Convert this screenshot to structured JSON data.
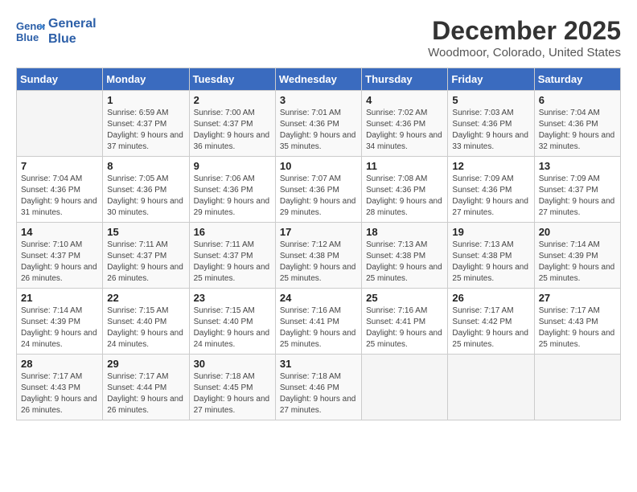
{
  "header": {
    "logo_line1": "General",
    "logo_line2": "Blue",
    "title": "December 2025",
    "subtitle": "Woodmoor, Colorado, United States"
  },
  "weekdays": [
    "Sunday",
    "Monday",
    "Tuesday",
    "Wednesday",
    "Thursday",
    "Friday",
    "Saturday"
  ],
  "weeks": [
    [
      {
        "day": "",
        "sunrise": "",
        "sunset": "",
        "daylight": ""
      },
      {
        "day": "1",
        "sunrise": "Sunrise: 6:59 AM",
        "sunset": "Sunset: 4:37 PM",
        "daylight": "Daylight: 9 hours and 37 minutes."
      },
      {
        "day": "2",
        "sunrise": "Sunrise: 7:00 AM",
        "sunset": "Sunset: 4:37 PM",
        "daylight": "Daylight: 9 hours and 36 minutes."
      },
      {
        "day": "3",
        "sunrise": "Sunrise: 7:01 AM",
        "sunset": "Sunset: 4:36 PM",
        "daylight": "Daylight: 9 hours and 35 minutes."
      },
      {
        "day": "4",
        "sunrise": "Sunrise: 7:02 AM",
        "sunset": "Sunset: 4:36 PM",
        "daylight": "Daylight: 9 hours and 34 minutes."
      },
      {
        "day": "5",
        "sunrise": "Sunrise: 7:03 AM",
        "sunset": "Sunset: 4:36 PM",
        "daylight": "Daylight: 9 hours and 33 minutes."
      },
      {
        "day": "6",
        "sunrise": "Sunrise: 7:04 AM",
        "sunset": "Sunset: 4:36 PM",
        "daylight": "Daylight: 9 hours and 32 minutes."
      }
    ],
    [
      {
        "day": "7",
        "sunrise": "Sunrise: 7:04 AM",
        "sunset": "Sunset: 4:36 PM",
        "daylight": "Daylight: 9 hours and 31 minutes."
      },
      {
        "day": "8",
        "sunrise": "Sunrise: 7:05 AM",
        "sunset": "Sunset: 4:36 PM",
        "daylight": "Daylight: 9 hours and 30 minutes."
      },
      {
        "day": "9",
        "sunrise": "Sunrise: 7:06 AM",
        "sunset": "Sunset: 4:36 PM",
        "daylight": "Daylight: 9 hours and 29 minutes."
      },
      {
        "day": "10",
        "sunrise": "Sunrise: 7:07 AM",
        "sunset": "Sunset: 4:36 PM",
        "daylight": "Daylight: 9 hours and 29 minutes."
      },
      {
        "day": "11",
        "sunrise": "Sunrise: 7:08 AM",
        "sunset": "Sunset: 4:36 PM",
        "daylight": "Daylight: 9 hours and 28 minutes."
      },
      {
        "day": "12",
        "sunrise": "Sunrise: 7:09 AM",
        "sunset": "Sunset: 4:36 PM",
        "daylight": "Daylight: 9 hours and 27 minutes."
      },
      {
        "day": "13",
        "sunrise": "Sunrise: 7:09 AM",
        "sunset": "Sunset: 4:37 PM",
        "daylight": "Daylight: 9 hours and 27 minutes."
      }
    ],
    [
      {
        "day": "14",
        "sunrise": "Sunrise: 7:10 AM",
        "sunset": "Sunset: 4:37 PM",
        "daylight": "Daylight: 9 hours and 26 minutes."
      },
      {
        "day": "15",
        "sunrise": "Sunrise: 7:11 AM",
        "sunset": "Sunset: 4:37 PM",
        "daylight": "Daylight: 9 hours and 26 minutes."
      },
      {
        "day": "16",
        "sunrise": "Sunrise: 7:11 AM",
        "sunset": "Sunset: 4:37 PM",
        "daylight": "Daylight: 9 hours and 25 minutes."
      },
      {
        "day": "17",
        "sunrise": "Sunrise: 7:12 AM",
        "sunset": "Sunset: 4:38 PM",
        "daylight": "Daylight: 9 hours and 25 minutes."
      },
      {
        "day": "18",
        "sunrise": "Sunrise: 7:13 AM",
        "sunset": "Sunset: 4:38 PM",
        "daylight": "Daylight: 9 hours and 25 minutes."
      },
      {
        "day": "19",
        "sunrise": "Sunrise: 7:13 AM",
        "sunset": "Sunset: 4:38 PM",
        "daylight": "Daylight: 9 hours and 25 minutes."
      },
      {
        "day": "20",
        "sunrise": "Sunrise: 7:14 AM",
        "sunset": "Sunset: 4:39 PM",
        "daylight": "Daylight: 9 hours and 25 minutes."
      }
    ],
    [
      {
        "day": "21",
        "sunrise": "Sunrise: 7:14 AM",
        "sunset": "Sunset: 4:39 PM",
        "daylight": "Daylight: 9 hours and 24 minutes."
      },
      {
        "day": "22",
        "sunrise": "Sunrise: 7:15 AM",
        "sunset": "Sunset: 4:40 PM",
        "daylight": "Daylight: 9 hours and 24 minutes."
      },
      {
        "day": "23",
        "sunrise": "Sunrise: 7:15 AM",
        "sunset": "Sunset: 4:40 PM",
        "daylight": "Daylight: 9 hours and 24 minutes."
      },
      {
        "day": "24",
        "sunrise": "Sunrise: 7:16 AM",
        "sunset": "Sunset: 4:41 PM",
        "daylight": "Daylight: 9 hours and 25 minutes."
      },
      {
        "day": "25",
        "sunrise": "Sunrise: 7:16 AM",
        "sunset": "Sunset: 4:41 PM",
        "daylight": "Daylight: 9 hours and 25 minutes."
      },
      {
        "day": "26",
        "sunrise": "Sunrise: 7:17 AM",
        "sunset": "Sunset: 4:42 PM",
        "daylight": "Daylight: 9 hours and 25 minutes."
      },
      {
        "day": "27",
        "sunrise": "Sunrise: 7:17 AM",
        "sunset": "Sunset: 4:43 PM",
        "daylight": "Daylight: 9 hours and 25 minutes."
      }
    ],
    [
      {
        "day": "28",
        "sunrise": "Sunrise: 7:17 AM",
        "sunset": "Sunset: 4:43 PM",
        "daylight": "Daylight: 9 hours and 26 minutes."
      },
      {
        "day": "29",
        "sunrise": "Sunrise: 7:17 AM",
        "sunset": "Sunset: 4:44 PM",
        "daylight": "Daylight: 9 hours and 26 minutes."
      },
      {
        "day": "30",
        "sunrise": "Sunrise: 7:18 AM",
        "sunset": "Sunset: 4:45 PM",
        "daylight": "Daylight: 9 hours and 27 minutes."
      },
      {
        "day": "31",
        "sunrise": "Sunrise: 7:18 AM",
        "sunset": "Sunset: 4:46 PM",
        "daylight": "Daylight: 9 hours and 27 minutes."
      },
      {
        "day": "",
        "sunrise": "",
        "sunset": "",
        "daylight": ""
      },
      {
        "day": "",
        "sunrise": "",
        "sunset": "",
        "daylight": ""
      },
      {
        "day": "",
        "sunrise": "",
        "sunset": "",
        "daylight": ""
      }
    ]
  ]
}
